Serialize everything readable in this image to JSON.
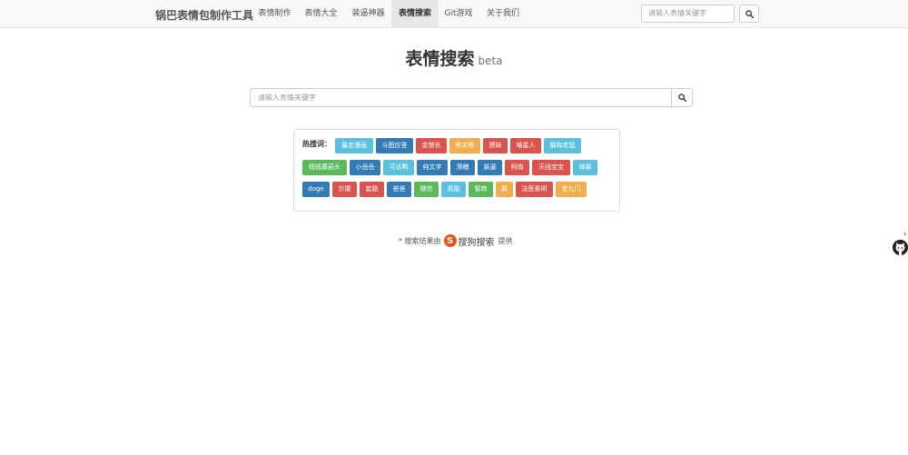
{
  "navbar": {
    "brand": "锅巴表情包制作工具",
    "items": [
      {
        "label": "表情制作"
      },
      {
        "label": "表情大全"
      },
      {
        "label": "装逼神器"
      },
      {
        "label": "表情搜索"
      },
      {
        "label": "Git游戏"
      },
      {
        "label": "关于我们"
      }
    ],
    "active_item": "表情搜索",
    "search_placeholder": "请输入表情关键字"
  },
  "page": {
    "title": "表情搜索",
    "badge": "beta",
    "search_placeholder": "请输入表情关键字"
  },
  "hot_words": {
    "label": "热搜词：",
    "tags": [
      {
        "text": "暴走漫画",
        "color": "info"
      },
      {
        "text": "斗图应答",
        "color": "primary"
      },
      {
        "text": "金馆长",
        "color": "danger"
      },
      {
        "text": "熊本熊",
        "color": "warning"
      },
      {
        "text": "撩妹",
        "color": "danger"
      },
      {
        "text": "喵星人",
        "color": "danger"
      },
      {
        "text": "猫和老鼠",
        "color": "info"
      },
      {
        "text": "贱贱蘑菇头",
        "color": "success"
      },
      {
        "text": "小岳岳",
        "color": "primary"
      },
      {
        "text": "可达鸭",
        "color": "info"
      },
      {
        "text": "纯文字",
        "color": "primary"
      },
      {
        "text": "滑稽",
        "color": "primary"
      },
      {
        "text": "装逼",
        "color": "primary"
      },
      {
        "text": "柯南",
        "color": "danger"
      },
      {
        "text": "天线宝宝",
        "color": "danger"
      },
      {
        "text": "弹幕",
        "color": "info"
      },
      {
        "text": "doge",
        "color": "primary"
      },
      {
        "text": "尔康",
        "color": "danger"
      },
      {
        "text": "套路",
        "color": "danger"
      },
      {
        "text": "爸爸",
        "color": "primary"
      },
      {
        "text": "微信",
        "color": "success"
      },
      {
        "text": "高能",
        "color": "info"
      },
      {
        "text": "智商",
        "color": "success"
      },
      {
        "text": "群",
        "color": "warning"
      },
      {
        "text": "法医秦明",
        "color": "danger"
      },
      {
        "text": "老九门",
        "color": "warning"
      }
    ]
  },
  "credit": {
    "prefix": "* 搜索结果由",
    "brand_letter": "S",
    "brand": "搜狗搜索",
    "suffix": "提供"
  },
  "side": {
    "chevron": "›"
  },
  "icons": {
    "nav_search": "search-icon",
    "main_search": "search-icon",
    "sogou": "sogou-logo-icon",
    "octocat": "github-octocat-icon"
  },
  "colors": {
    "info": "#5bc0de",
    "primary": "#337ab7",
    "danger": "#d9534f",
    "warning": "#f0ad4e",
    "success": "#5cb85c",
    "sogou": "#e4561b",
    "navbar_bg": "#f8f8f8",
    "nav_active_bg": "#e7e7e7"
  }
}
